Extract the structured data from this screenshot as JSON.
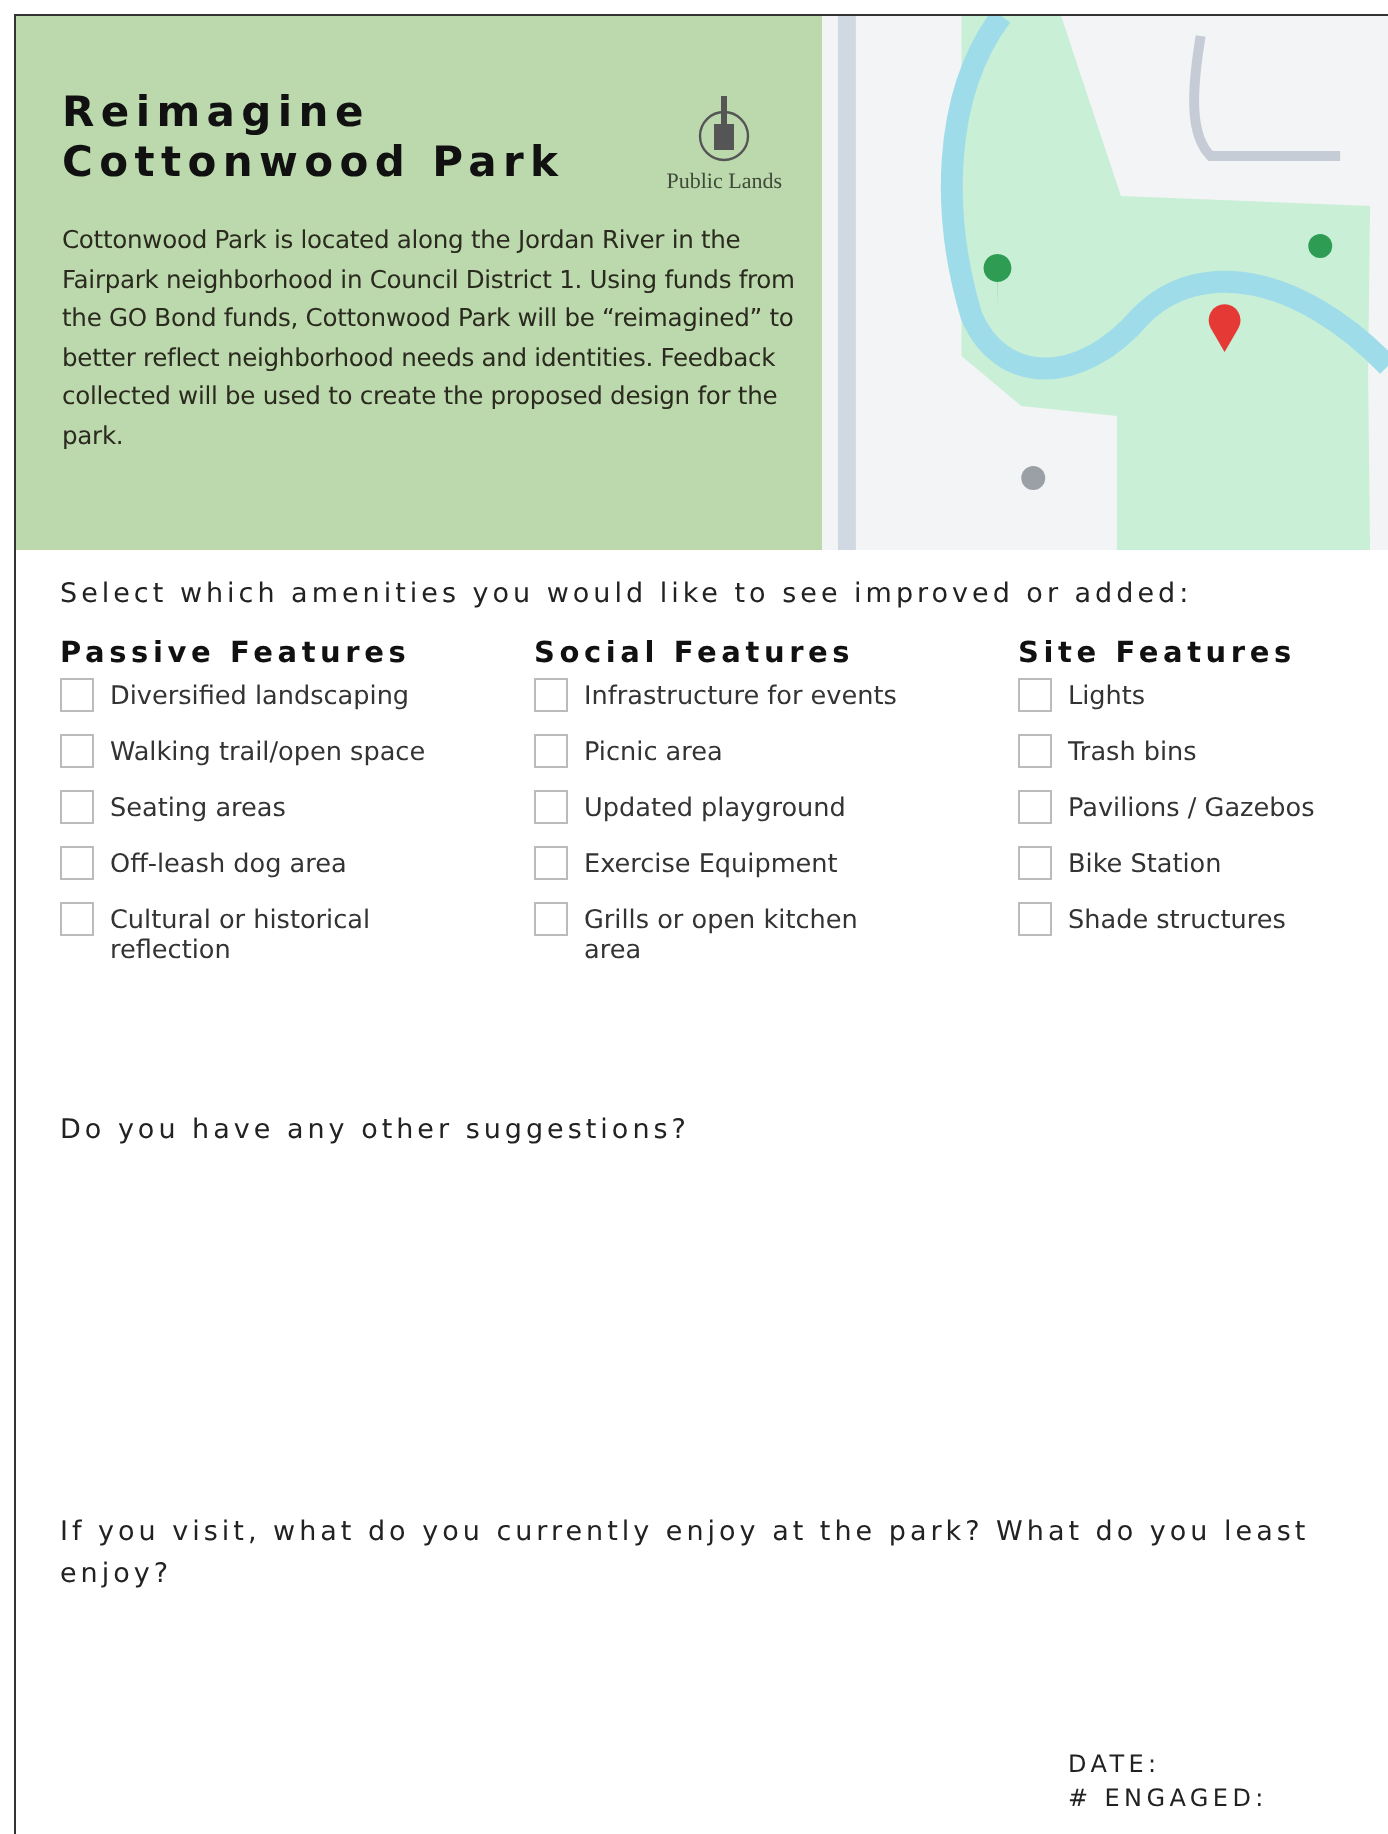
{
  "header": {
    "title_lines": [
      "Reimagine",
      "Cottonwood Park"
    ],
    "logo_text": "Public Lands",
    "intro": "Cottonwood Park is located along the Jordan River in the Fairpark neighborhood in Council District 1. Using funds from the GO Bond funds, Cottonwood Park will be “reimagined” to better reflect neighborhood needs and identities. Feedback collected will be used to create the proposed design for the park."
  },
  "amenities": {
    "prompt": "Select which amenities you would like to see improved or added:",
    "groups": [
      {
        "heading": "Passive Features",
        "items": [
          {
            "label": "Diversified landscaping",
            "checked": false
          },
          {
            "label": "Walking trail/open space",
            "checked": false
          },
          {
            "label": "Seating areas",
            "checked": false
          },
          {
            "label": "Off-leash dog area",
            "checked": false
          },
          {
            "label": "Cultural or historical reflection",
            "checked": false
          }
        ]
      },
      {
        "heading": "Social Features",
        "items": [
          {
            "label": "Infrastructure for events",
            "checked": false
          },
          {
            "label": "Picnic area",
            "checked": false
          },
          {
            "label": "Updated playground",
            "checked": false
          },
          {
            "label": "Exercise Equipment",
            "checked": false
          },
          {
            "label": "Grills or open kitchen area",
            "checked": false
          }
        ]
      },
      {
        "heading": "Site Features",
        "items": [
          {
            "label": "Lights",
            "checked": false
          },
          {
            "label": "Trash bins",
            "checked": false
          },
          {
            "label": "Pavilions / Gazebos",
            "checked": false
          },
          {
            "label": "Bike Station",
            "checked": false
          },
          {
            "label": "Shade structures",
            "checked": false
          }
        ]
      }
    ]
  },
  "questions": [
    "Do you have any other suggestions?",
    "If you visit, what do you currently enjoy at the park? What do you least enjoy?"
  ],
  "footer_labels": [
    "DATE:",
    "# ENGAGED:"
  ]
}
